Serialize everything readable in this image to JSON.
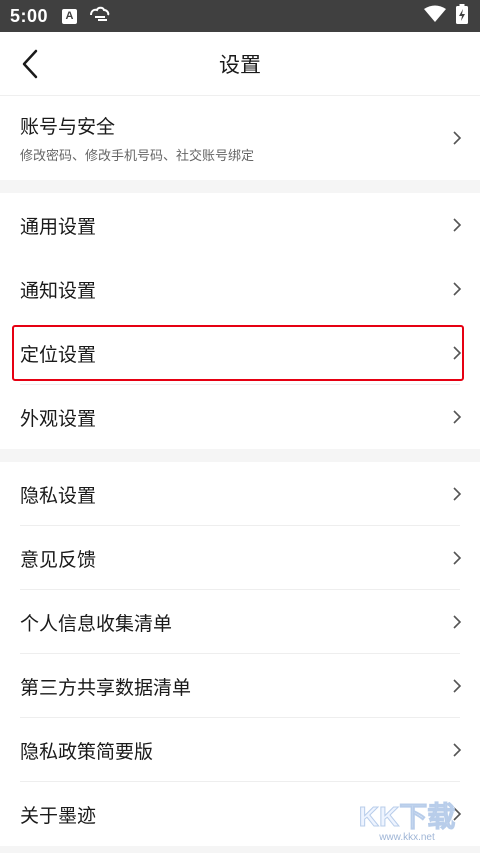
{
  "status_bar": {
    "time": "5:00",
    "badge_a": "A",
    "icons": [
      "a-notification-icon",
      "cloud-sync-icon",
      "wifi-icon",
      "battery-charging-icon"
    ]
  },
  "nav": {
    "title": "设置",
    "back_icon": "chevron-left-icon"
  },
  "groups": [
    {
      "items": [
        {
          "label": "账号与安全",
          "sublabel": "修改密码、修改手机号码、社交账号绑定"
        }
      ]
    },
    {
      "items": [
        {
          "label": "通用设置"
        },
        {
          "label": "通知设置"
        },
        {
          "label": "定位设置",
          "highlighted": true
        },
        {
          "label": "外观设置"
        }
      ]
    },
    {
      "items": [
        {
          "label": "隐私设置"
        },
        {
          "label": "意见反馈"
        },
        {
          "label": "个人信息收集清单"
        },
        {
          "label": "第三方共享数据清单"
        },
        {
          "label": "隐私政策简要版"
        },
        {
          "label": "关于墨迹"
        }
      ]
    }
  ],
  "colors": {
    "highlight": "#e60012",
    "status_bar": "#404040",
    "watermark": "#e0ecff"
  },
  "watermark": {
    "logo_text": "KK下载",
    "url": "www.kkx.net"
  }
}
